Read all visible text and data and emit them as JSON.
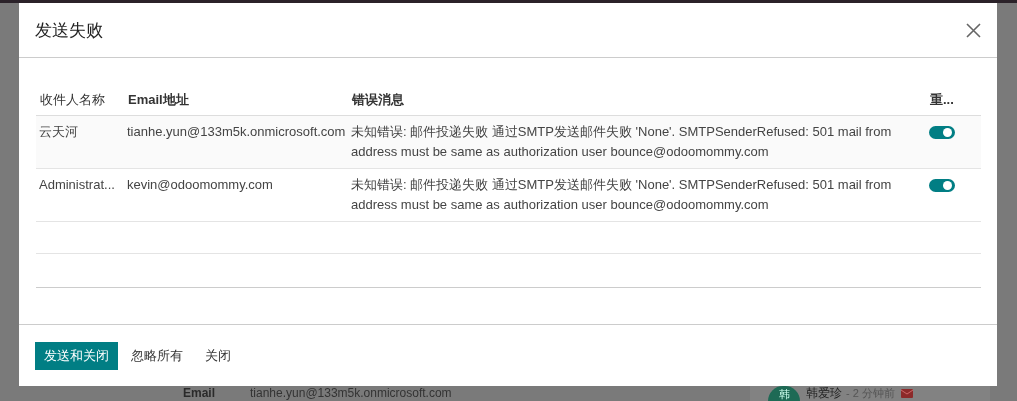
{
  "background": {
    "field_label": "Email",
    "field_value": "tianhe.yun@133m5k.onmicrosoft.com",
    "message": {
      "avatar": "韩",
      "author": "韩爱珍",
      "time": "- 2 分钟前"
    }
  },
  "dialog": {
    "title": "发送失败",
    "columns": [
      "收件人名称",
      "Email地址",
      "错误消息",
      "重..."
    ],
    "rows": [
      {
        "recipient": "云天河",
        "email": "tianhe.yun@133m5k.onmicrosoft.com",
        "error": "未知错误: 邮件投递失败 通过SMTP发送邮件失败 'None'. SMTPSenderRefused: 501 mail from address must be same as authorization user bounce@odoomommy.com",
        "resend": true
      },
      {
        "recipient": "Administrat...",
        "email": "kevin@odoomommy.com",
        "error": "未知错误: 邮件投递失败 通过SMTP发送邮件失败 'None'. SMTPSenderRefused: 501 mail from address must be same as authorization user bounce@odoomommy.com",
        "resend": true
      }
    ],
    "buttons": [
      {
        "label": "发送和关闭",
        "kind": "primary"
      },
      {
        "label": "忽略所有",
        "kind": "link"
      },
      {
        "label": "关闭",
        "kind": "link"
      }
    ]
  }
}
